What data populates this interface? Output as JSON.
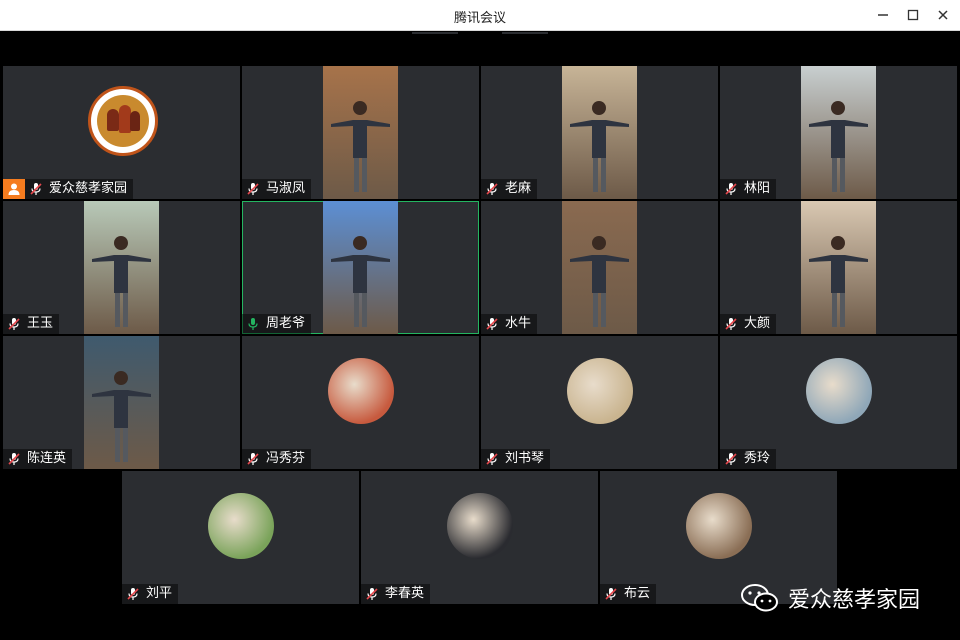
{
  "window": {
    "title": "腾讯会议"
  },
  "participants": [
    {
      "name": "爱众慈孝家园",
      "host": true,
      "mic": "muted",
      "kind": "logo"
    },
    {
      "name": "马淑凤",
      "mic": "muted",
      "kind": "video",
      "bg": "#a7734a"
    },
    {
      "name": "老麻",
      "mic": "muted",
      "kind": "video",
      "bg": "#c7b497"
    },
    {
      "name": "林阳",
      "mic": "muted",
      "kind": "video",
      "bg": "#c8cfd0"
    },
    {
      "name": "王玉",
      "mic": "muted",
      "kind": "video",
      "bg": "#b8c9b8"
    },
    {
      "name": "周老爷",
      "mic": "active",
      "kind": "video",
      "bg": "#5c8fd4",
      "active": true
    },
    {
      "name": "水牛",
      "mic": "muted",
      "kind": "video",
      "bg": "#8a6a50"
    },
    {
      "name": "大颜",
      "mic": "muted",
      "kind": "video",
      "bg": "#d9c8b2"
    },
    {
      "name": "陈连英",
      "mic": "muted",
      "kind": "video",
      "bg": "#3f5a6e"
    },
    {
      "name": "冯秀芬",
      "mic": "muted",
      "kind": "avatar",
      "bg": "#c75a3e"
    },
    {
      "name": "刘书琴",
      "mic": "muted",
      "kind": "avatar",
      "bg": "#c9b48f"
    },
    {
      "name": "秀玲",
      "mic": "muted",
      "kind": "avatar",
      "bg": "#8fa7b8"
    },
    {
      "name": "刘平",
      "mic": "muted",
      "kind": "avatar",
      "bg": "#7aa35a"
    },
    {
      "name": "李春英",
      "mic": "muted",
      "kind": "avatar",
      "bg": "#2a2b30"
    },
    {
      "name": "布云",
      "mic": "muted",
      "kind": "avatar",
      "bg": "#8a6e55"
    }
  ],
  "watermark": {
    "text": "爱众慈孝家园",
    "icon": "wechat-icon"
  },
  "colors": {
    "tile_bg": "#2b2d31",
    "active_border": "#24b561",
    "host_badge": "#f57c1f",
    "mic_muted": "#e5484d"
  }
}
